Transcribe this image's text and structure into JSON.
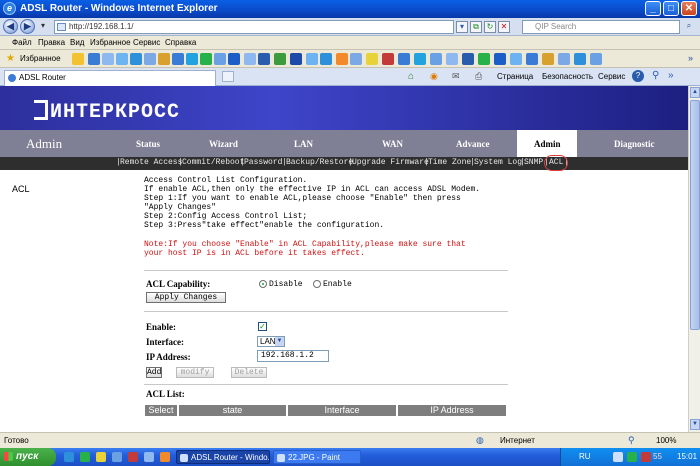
{
  "window": {
    "title": "ADSL Router - Windows Internet Explorer",
    "minimize": "_",
    "maximize": "□",
    "close": "✕"
  },
  "browser": {
    "url": "http://192.168.1.1/",
    "search_placeholder": "QIP Search",
    "menu": [
      "Файл",
      "Правка",
      "Вид",
      "Избранное",
      "Сервис",
      "Справка"
    ],
    "favorites_label": "Избранное",
    "tab_title": "ADSL Router",
    "commands": {
      "page": "Страница",
      "security": "Безопасность",
      "tools": "Сервис",
      "help": "?"
    },
    "status_left": "Готово",
    "status_zone": "Интернет",
    "zoom": "100%"
  },
  "router": {
    "brand": "ИНТЕРКРОСС",
    "section_title": "Admin",
    "main_tabs": [
      "Status",
      "Wizard",
      "LAN",
      "WAN",
      "Advance",
      "Admin",
      "Diagnostic"
    ],
    "active_tab": "Admin",
    "sub_tabs": [
      "Remote Access",
      "Commit/Reboot",
      "Password",
      "Backup/Restore",
      "Upgrade Firmware",
      "Time Zone",
      "System Log",
      "SNMP",
      "ACL"
    ],
    "active_sub_tab": "ACL",
    "side_label": "ACL",
    "description": [
      "Access Control List Configuration.",
      "If enable ACL,then only the effective IP in ACL can access ADSL Modem.",
      "Step 1:If you want to enable ACL,please choose \"Enable\" then press",
      "\"Apply Changes\"",
      "Step 2:Config Access Control List;",
      "Step 3:Press\"take effect\"enable the configuration."
    ],
    "note": [
      "Note:If you choose \"Enable\" in ACL Capability,please make sure that",
      "your host IP is in ACL before it takes effect."
    ],
    "acl_capability": {
      "label": "ACL Capability:",
      "options": [
        "Disable",
        "Enable"
      ],
      "selected": "Disable",
      "apply_label": "Apply Changes"
    },
    "entry": {
      "enable_label": "Enable:",
      "enable_checked": true,
      "interface_label": "Interface:",
      "interface_value": "LAN",
      "ip_label": "IP Address:",
      "ip_value": "192.168.1.2",
      "add_label": "Add",
      "modify_label": "modify",
      "delete_label": "Delete"
    },
    "acl_list": {
      "label": "ACL List:",
      "columns": [
        "Select",
        "state",
        "Interface",
        "IP Address"
      ]
    }
  },
  "taskbar": {
    "start_label": "пуск",
    "tasks": [
      "ADSL Router - Windo...",
      "22.JPG - Paint"
    ],
    "lang": "RU",
    "clock": "15:01",
    "tray_count": "55"
  },
  "colors": {
    "banner": "#3e45c9",
    "nav_bar": "#7f7f95",
    "sub_nav": "#2e2e2e",
    "note_text": "#d01010",
    "acl_highlight": "#e23c3c"
  }
}
